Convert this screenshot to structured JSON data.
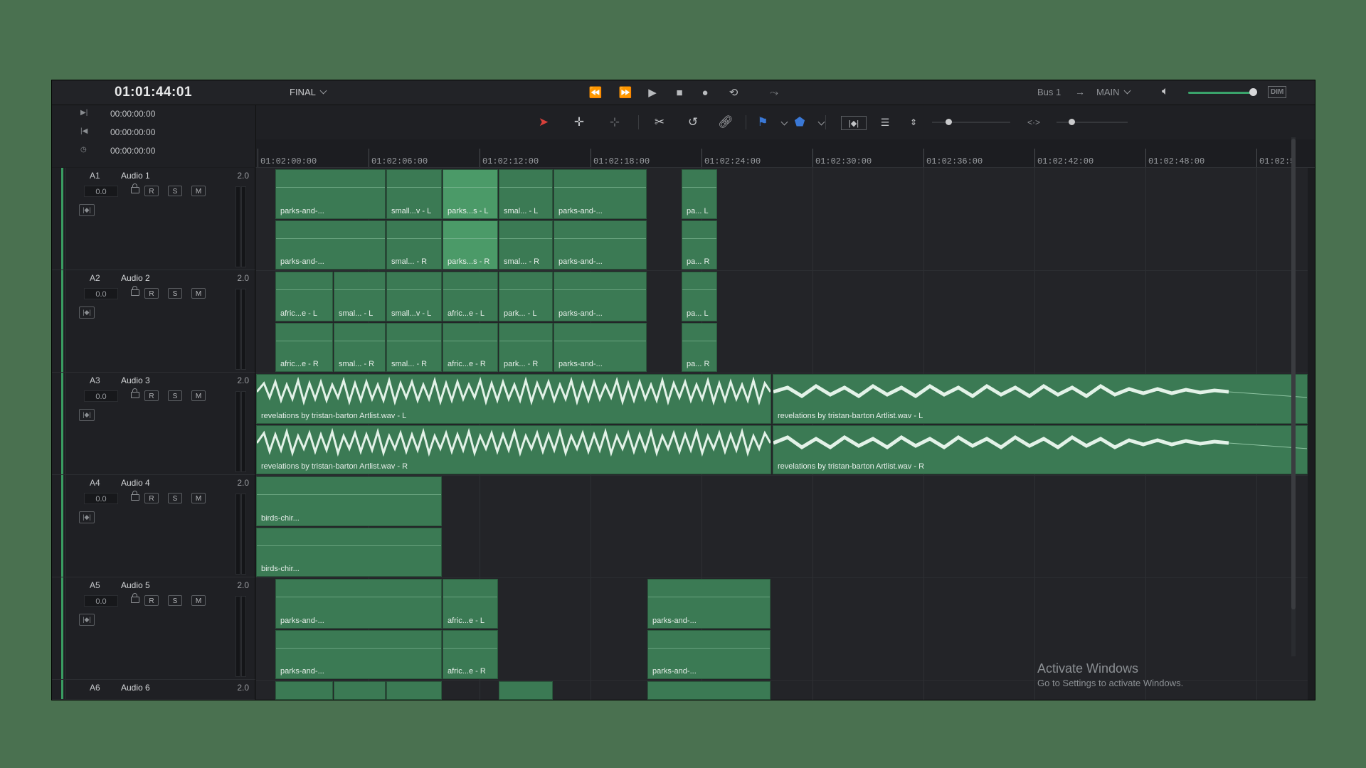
{
  "header": {
    "master_timecode": "01:01:44:01",
    "timeline_name": "FINAL",
    "bus": "Bus 1",
    "output": "MAIN",
    "dim_label": "DIM",
    "volume_level": 0.92
  },
  "timecodes": [
    "00:00:00:00",
    "00:00:00:00",
    "00:00:00:00"
  ],
  "ruler": [
    "01:02:00:00",
    "01:02:06:00",
    "01:02:12:00",
    "01:02:18:00",
    "01:02:24:00",
    "01:02:30:00",
    "01:02:36:00",
    "01:02:42:00",
    "01:02:48:00",
    "01:02:5"
  ],
  "tracks": [
    {
      "id": "A1",
      "name": "Audio 1",
      "format": "2.0",
      "volume": "0.0",
      "r": "R",
      "s": "S",
      "m": "M"
    },
    {
      "id": "A2",
      "name": "Audio 2",
      "format": "2.0",
      "volume": "0.0",
      "r": "R",
      "s": "S",
      "m": "M"
    },
    {
      "id": "A3",
      "name": "Audio 3",
      "format": "2.0",
      "volume": "0.0",
      "r": "R",
      "s": "S",
      "m": "M"
    },
    {
      "id": "A4",
      "name": "Audio 4",
      "format": "2.0",
      "volume": "0.0",
      "r": "R",
      "s": "S",
      "m": "M"
    },
    {
      "id": "A5",
      "name": "Audio 5",
      "format": "2.0",
      "volume": "0.0",
      "r": "R",
      "s": "S",
      "m": "M"
    },
    {
      "id": "A6",
      "name": "Audio 6",
      "format": "2.0",
      "volume": "",
      "r": "",
      "s": "",
      "m": ""
    }
  ],
  "clips": {
    "a1_l": [
      "parks-and-...",
      "small...v - L",
      "parks...s - L",
      "smal... - L",
      "parks-and-...",
      "pa... L"
    ],
    "a1_r": [
      "parks-and-...",
      "smal... - R",
      "parks...s - R",
      "smal... - R",
      "parks-and-...",
      "pa... R"
    ],
    "a2_l": [
      "afric...e - L",
      "smal... - L",
      "small...v - L",
      "afric...e - L",
      "park... - L",
      "parks-and-...",
      "pa... L"
    ],
    "a2_r": [
      "afric...e - R",
      "smal... - R",
      "smal... - R",
      "afric...e - R",
      "park... - R",
      "parks-and-...",
      "pa... R"
    ],
    "a3_l": [
      "revelations by tristan-barton Artlist.wav - L",
      "revelations by tristan-barton Artlist.wav - L"
    ],
    "a3_r": [
      "revelations by tristan-barton Artlist.wav - R",
      "revelations by tristan-barton Artlist.wav - R"
    ],
    "a4_l": [
      "birds-chir..."
    ],
    "a4_r": [
      "birds-chir..."
    ],
    "a5_l": [
      "parks-and-...",
      "afric...e - L",
      "parks-and-..."
    ],
    "a5_r": [
      "parks-and-...",
      "afric...e - R",
      "parks-and-..."
    ]
  },
  "watermark": {
    "line1": "Activate Windows",
    "line2": "Go to Settings to activate Windows."
  }
}
